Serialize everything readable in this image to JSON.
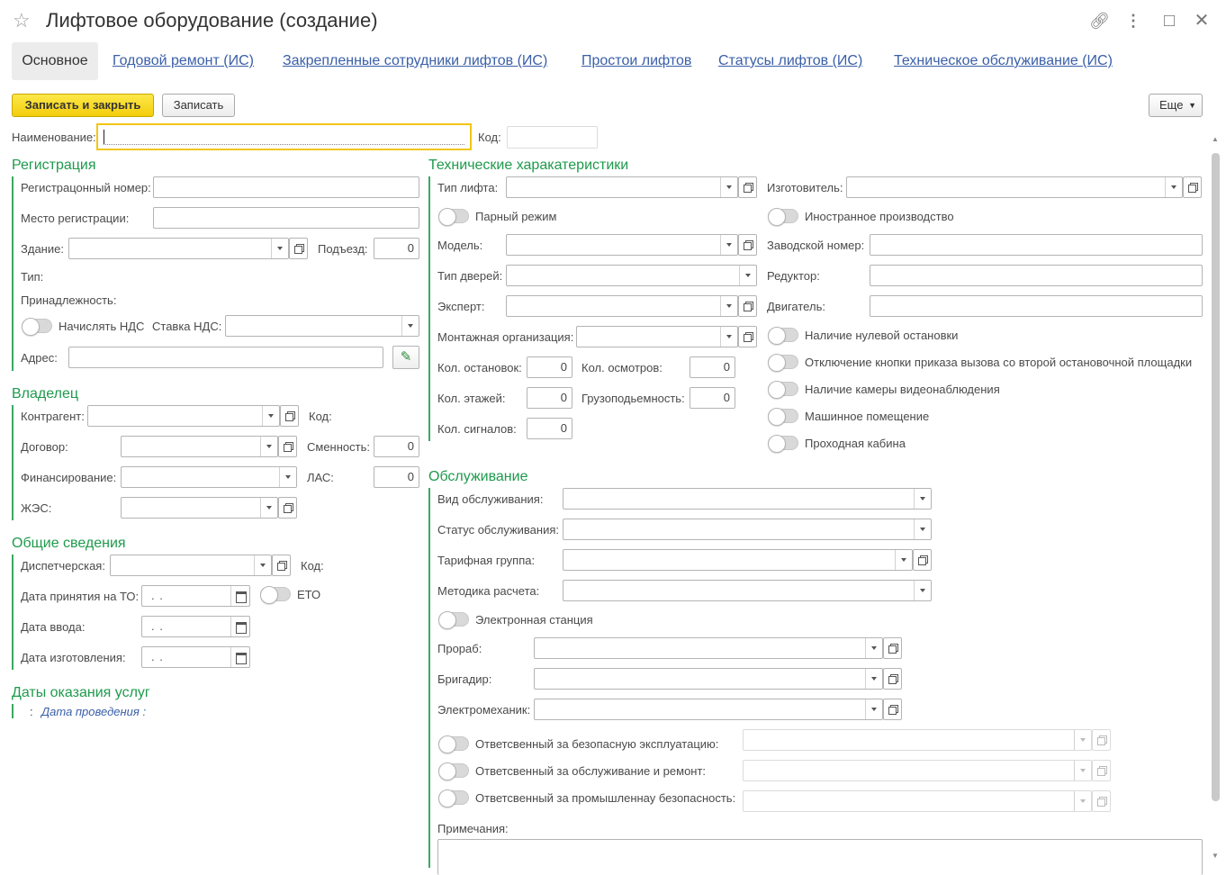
{
  "window": {
    "title": "Лифтовое оборудование (создание)"
  },
  "tabs": {
    "main": "Основное",
    "t1": "Годовой ремонт (ИС)",
    "t2": "Закрепленные сотрудники лифтов (ИС)",
    "t3": "Простои лифтов",
    "t4": "Статусы лифтов (ИС)",
    "t5": "Техническое обслуживание (ИС)"
  },
  "toolbar": {
    "save_close": "Записать и закрыть",
    "save": "Записать",
    "more": "Еще"
  },
  "header": {
    "name_label": "Наименование:",
    "code_label": "Код:"
  },
  "reg": {
    "title": "Регистрация",
    "reg_num": "Регистрацонный номер:",
    "place": "Место регистрации:",
    "building": "Здание:",
    "entrance": "Подъезд:",
    "entrance_val": "0",
    "type": "Тип:",
    "belong": "Принадлежность:",
    "vat": "Начислять НДС",
    "vat_rate": "Ставка НДС:",
    "address": "Адрес:"
  },
  "owner": {
    "title": "Владелец",
    "contractor": "Контрагент:",
    "code": "Код:",
    "contract": "Договор:",
    "shift": "Сменность:",
    "shift_val": "0",
    "finance": "Финансирование:",
    "las": "ЛАС:",
    "las_val": "0",
    "zhes": "ЖЭС:"
  },
  "general": {
    "title": "Общие сведения",
    "dispatch": "Диспетчерская:",
    "code": "Код:",
    "to_date": "Дата принятия на ТО:",
    "eto": "ЕТО",
    "input_date": "Дата ввода:",
    "manuf_date": "Дата изготовления:",
    "date_mask": ". ."
  },
  "services": {
    "title": "Даты оказания услуг",
    "colon": ":",
    "date_label": "Дата проведения :"
  },
  "tech": {
    "title": "Технические харакатеристики",
    "lift_type": "Тип лифта:",
    "manufacturer": "Изготовитель:",
    "pair": "Парный режим",
    "foreign": "Иностранное производство",
    "model": "Модель:",
    "serial": "Заводской номер:",
    "door_type": "Тип дверей:",
    "reducer": "Редуктор:",
    "expert": "Эксперт:",
    "engine": "Двигатель:",
    "install_org": "Монтажная организация:",
    "zero_stop": "Наличие нулевой остановки",
    "disable_btn": "Отключение кнопки приказа вызова со второй остановочной площадки",
    "camera": "Наличие камеры видеонаблюдения",
    "machine_room": "Машинное помещение",
    "through_cab": "Проходная кабина",
    "stops": "Кол. остановок:",
    "stops_val": "0",
    "inspections": "Кол. осмотров:",
    "inspections_val": "0",
    "floors": "Кол. этажей:",
    "floors_val": "0",
    "capacity": "Грузоподьемность:",
    "capacity_val": "0",
    "signals": "Кол. сигналов:",
    "signals_val": "0"
  },
  "service": {
    "title": "Обслуживание",
    "kind": "Вид обслуживания:",
    "status": "Статус обслуживания:",
    "tariff": "Тарифная группа:",
    "method": "Методика расчета:",
    "station": "Электронная станция",
    "foreman": "Прораб:",
    "brigadier": "Бригадир:",
    "electromech": "Электромеханик:",
    "resp_safe": "Ответсвенный за безопасную эксплуатацию:",
    "resp_repair": "Ответсвенный за обслуживание и ремонт:",
    "resp_ind": "Ответсвенный за промышленнау безопасность:",
    "notes": "Примечания:"
  }
}
